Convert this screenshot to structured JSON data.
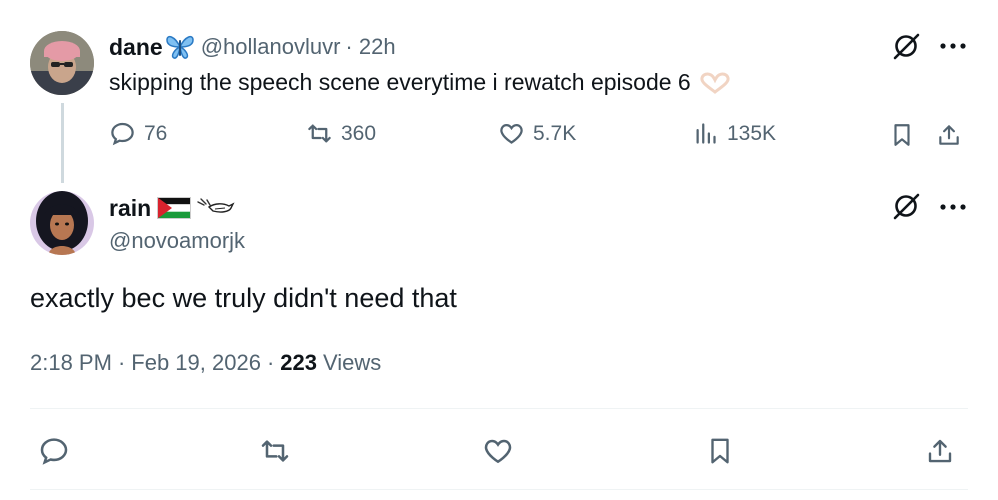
{
  "parent_tweet": {
    "author_name": "dane",
    "handle": "@hollanovluvr",
    "time": "· 22h",
    "text": "skipping the speech scene everytime i rewatch episode 6",
    "stats": {
      "replies": "76",
      "reposts": "360",
      "likes": "5.7K",
      "views": "135K"
    }
  },
  "reply_tweet": {
    "author_name": "rain",
    "handle": "@novoamorjk",
    "text": "exactly bec we truly didn't need that",
    "meta": {
      "time": "2:18 PM",
      "separator": "·",
      "date": "Feb 19, 2026",
      "separator2": "·",
      "views_count": "223",
      "views_label": "Views"
    }
  },
  "icons": {
    "verified_decoration": "butterfly-emoji",
    "heart_hands": "heart-hands-emoji",
    "flag": "palestine-flag-emoji",
    "dove": "dove-emoji",
    "grok": "grok-icon",
    "more": "more-dots-icon"
  },
  "colors": {
    "text": "#0f1419",
    "muted": "#536471",
    "divider": "#eff3f4",
    "butterfly": "#3b8fd9"
  }
}
